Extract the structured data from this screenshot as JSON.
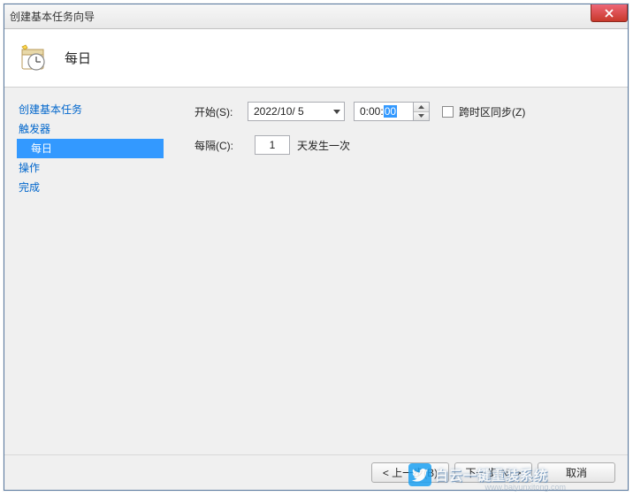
{
  "window": {
    "title": "创建基本任务向导"
  },
  "header": {
    "title": "每日"
  },
  "sidebar": {
    "items": [
      {
        "label": "创建基本任务",
        "sub": false,
        "selected": false
      },
      {
        "label": "触发器",
        "sub": false,
        "selected": false
      },
      {
        "label": "每日",
        "sub": true,
        "selected": true
      },
      {
        "label": "操作",
        "sub": false,
        "selected": false
      },
      {
        "label": "完成",
        "sub": false,
        "selected": false
      }
    ]
  },
  "form": {
    "start_label": "开始(S):",
    "date_value": "2022/10/ 5",
    "time_prefix": "0:00:",
    "time_selected": "00",
    "sync_tz_label": "跨时区同步(Z)",
    "interval_label": "每隔(C):",
    "interval_value": "1",
    "interval_suffix": "天发生一次"
  },
  "footer": {
    "back": "< 上一步(B)",
    "next": "下一步(N) >",
    "cancel": "取消"
  },
  "watermark": {
    "text": "白云一键重装系统",
    "url": "www.baiyunxitong.com"
  }
}
